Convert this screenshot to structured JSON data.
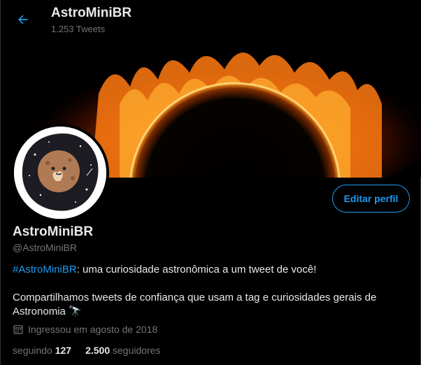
{
  "header": {
    "title": "AstroMiniBR",
    "tweet_count": "1.253 Tweets"
  },
  "profile": {
    "display_name": "AstroMiniBR",
    "handle": "@AstroMiniBR",
    "edit_button": "Editar perfil",
    "bio": {
      "hashtag": "#AstroMiniBR",
      "line1_rest": ": uma curiosidade astronômica a um tweet de você!",
      "line2": "Compartilhamos tweets de confiança que usam a tag e curiosidades gerais de Astronomia",
      "emoji": "🔭"
    },
    "joined": "Ingressou em agosto de 2018",
    "following_label": "seguindo",
    "following_count": "127",
    "followers_count": "2.500",
    "followers_label": "seguidores"
  },
  "colors": {
    "accent": "#1d9bf0",
    "background": "#000000",
    "muted": "#71767b"
  }
}
